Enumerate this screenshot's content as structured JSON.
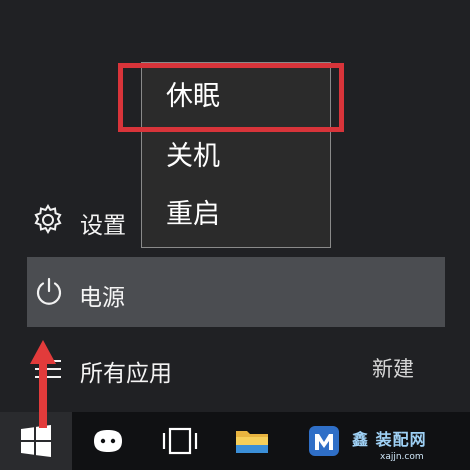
{
  "power_menu": {
    "items": [
      {
        "label": "休眠"
      },
      {
        "label": "关机"
      },
      {
        "label": "重启"
      }
    ],
    "highlight_color": "#d8343a"
  },
  "start_menu": {
    "settings_label": "设置",
    "power_label": "电源",
    "all_apps_label": "所有应用",
    "new_label": "新建"
  },
  "taskbar": {
    "items": [
      "windows-logo-icon",
      "cortana-icon",
      "task-view-icon",
      "file-explorer-icon",
      "maxthon-icon"
    ]
  },
  "watermark": {
    "text": "鑫 装配网",
    "sub": "xajjn.com"
  },
  "colors": {
    "background": "#202124",
    "selected_row": "#4b4d51",
    "taskbar": "#101113",
    "annotation_arrow": "#e23b3b"
  }
}
